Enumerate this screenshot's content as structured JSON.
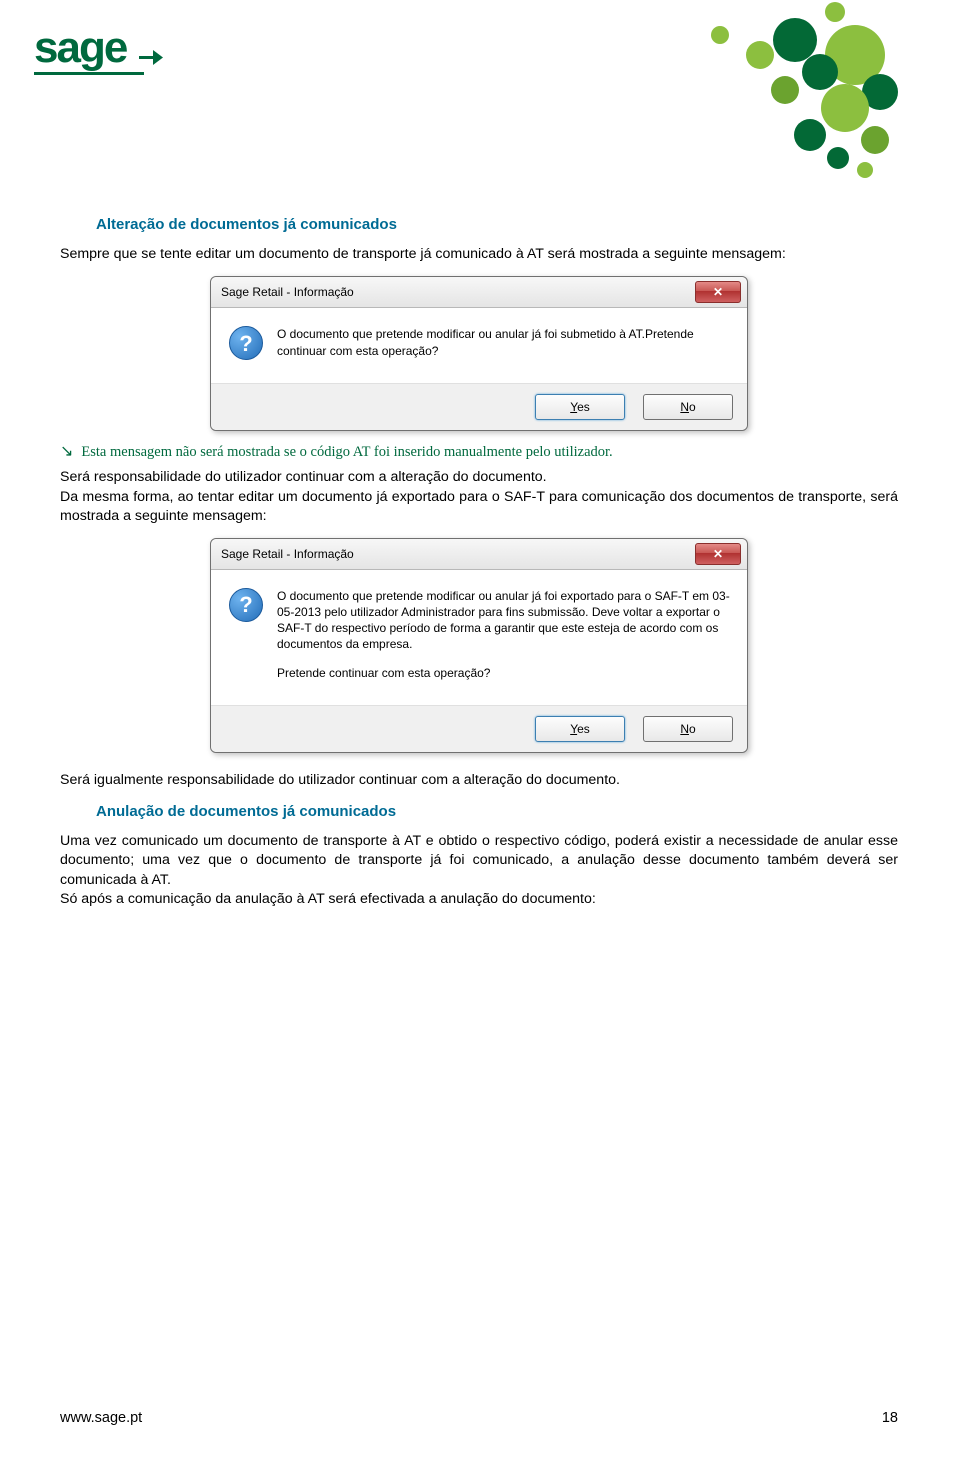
{
  "logo_alt": "sage",
  "sections": {
    "s1": {
      "title": "Alteração de documentos já comunicados",
      "intro": "Sempre que se tente editar um documento de transporte já comunicado à AT será mostrada a seguinte mensagem:"
    },
    "note1": "Esta mensagem não será mostrada se o código AT foi inserido manualmente pelo utilizador.",
    "p1": "Será responsabilidade do utilizador continuar com a alteração do documento.",
    "p2": "Da mesma forma, ao tentar editar um documento já exportado para o SAF-T para comunicação dos documentos de transporte, será mostrada a seguinte mensagem:",
    "p3": "Será igualmente responsabilidade do utilizador continuar com a alteração do documento.",
    "s2": {
      "title": "Anulação de documentos já comunicados",
      "p1": "Uma vez comunicado um documento de transporte à AT e obtido o respectivo código, poderá existir a necessidade de anular esse documento; uma vez que o documento de transporte já foi comunicado, a anulação desse documento também deverá ser comunicada à AT.",
      "p2": "Só após a comunicação da anulação à AT será efectivada a anulação do documento:"
    }
  },
  "dialog1": {
    "title": "Sage Retail - Informação",
    "msg1": "O documento que pretende modificar ou anular já foi submetido à AT.Pretende continuar com esta operação?",
    "yes": "Yes",
    "no": "No"
  },
  "dialog2": {
    "title": "Sage Retail - Informação",
    "msg1": "O documento que pretende modificar ou anular já foi exportado para o SAF-T em 03-05-2013 pelo utilizador Administrador para fins submissão. Deve voltar a exportar o SAF-T do respectivo período de forma a garantir que este esteja de acordo com os documentos da empresa.",
    "msg2": "Pretende continuar com esta operação?",
    "yes": "Yes",
    "no": "No"
  },
  "footer": {
    "url": "www.sage.pt",
    "page": "18"
  }
}
